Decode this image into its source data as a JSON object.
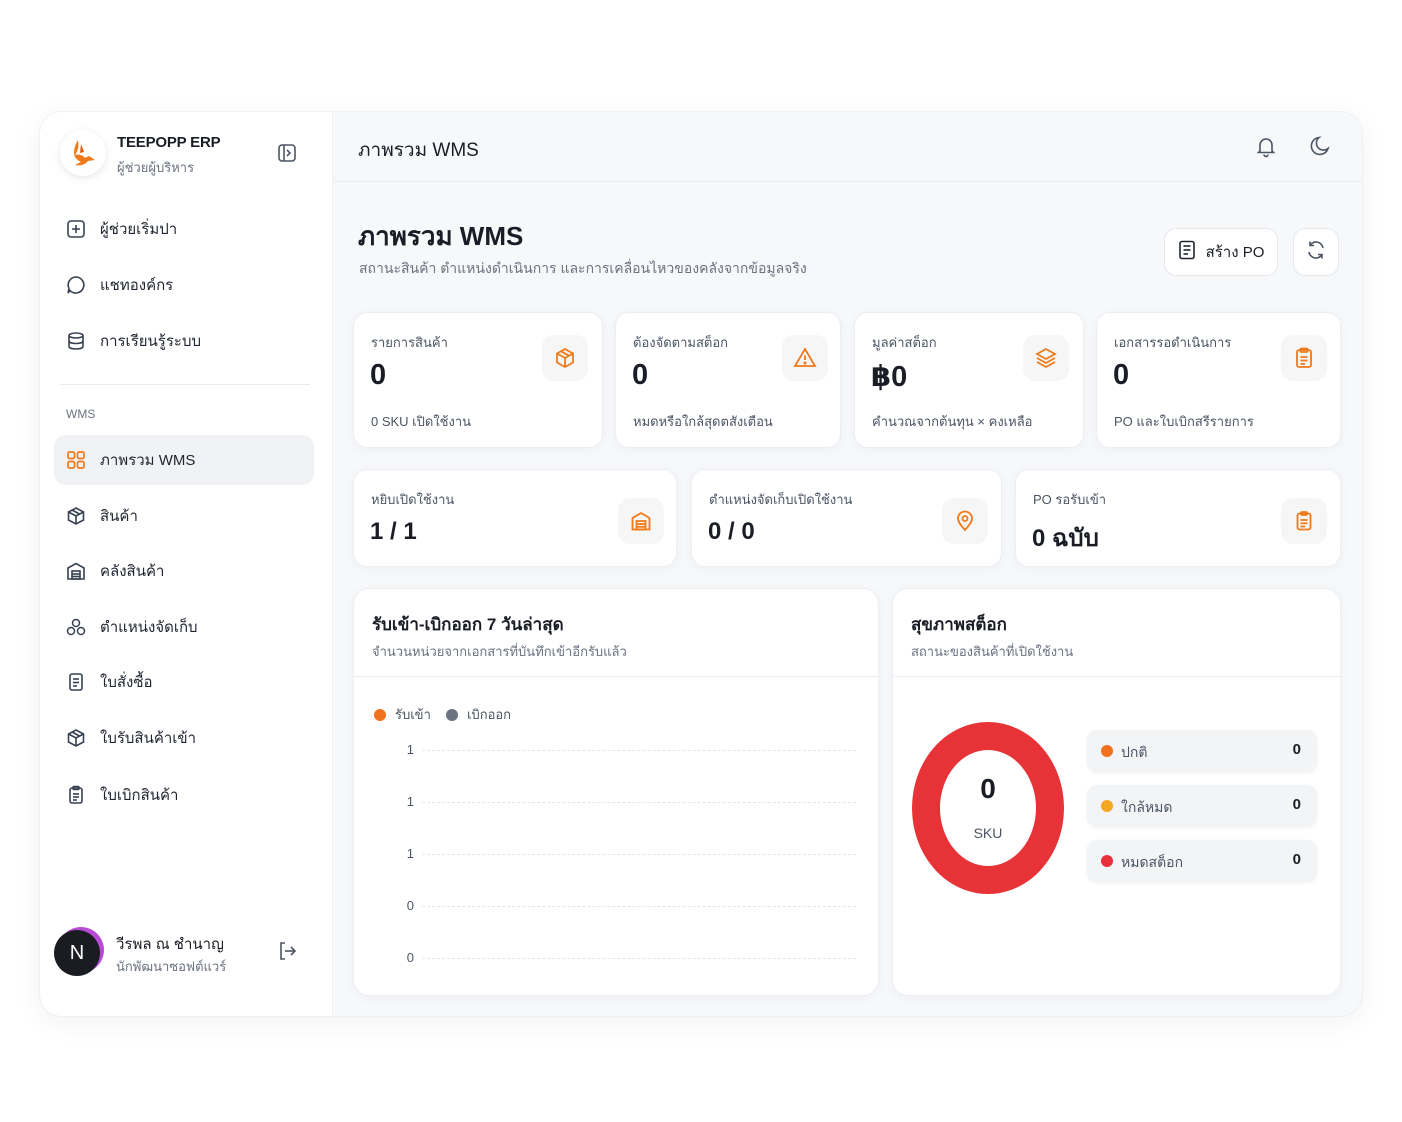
{
  "colors": {
    "accent": "#f07a1a",
    "inbound": "#f2711c",
    "outbound": "#6b7280",
    "normal": "#f2711c",
    "low": "#f5a623",
    "out": "#e8313b",
    "donut": "#e73338"
  },
  "brand": {
    "title": "TEEPOPP ERP",
    "subtitle": "ผู้ช่วยผู้บริหาร"
  },
  "nav_top": [
    {
      "label": "ผู้ช่วยเริ่มปา",
      "icon": "plus-square-icon"
    },
    {
      "label": "แชทองค์กร",
      "icon": "chat-bubble-icon"
    },
    {
      "label": "การเรียนรู้ระบบ",
      "icon": "database-icon"
    }
  ],
  "section_label": "WMS",
  "nav_wms": [
    {
      "label": "ภาพรวม WMS",
      "icon": "grid-icon",
      "active": true
    },
    {
      "label": "สินค้า",
      "icon": "box-icon"
    },
    {
      "label": "คลังสินค้า",
      "icon": "warehouse-icon"
    },
    {
      "label": "ตำแหน่งจัดเก็บ",
      "icon": "location-cluster-icon"
    },
    {
      "label": "ใบสั่งซื้อ",
      "icon": "document-icon"
    },
    {
      "label": "ใบรับสินค้าเข้า",
      "icon": "box-icon"
    },
    {
      "label": "ใบเบิกสินค้า",
      "icon": "clipboard-icon"
    }
  ],
  "user": {
    "initial": "N",
    "name": "วีรพล ณ ชำนาญ",
    "role": "นักพัฒนาซอฟต์แวร์"
  },
  "topbar": {
    "title": "ภาพรวม WMS"
  },
  "page": {
    "title": "ภาพรวม WMS",
    "subtitle": "สถานะสินค้า ตำแหน่งดำเนินการ และการเคลื่อนไหวของคลังจากข้อมูลจริง",
    "create_po": "สร้าง PO"
  },
  "stats": [
    {
      "label": "รายการสินค้า",
      "value": "0",
      "note": "0 SKU เปิดใช้งาน",
      "icon": "package-icon"
    },
    {
      "label": "ต้องจัดตามสต็อก",
      "value": "0",
      "note": "หมดหรือใกล้สุดตสังเตือน",
      "icon": "warning-triangle-icon"
    },
    {
      "label": "มูลค่าสต็อก",
      "value": "฿0",
      "note": "คำนวณจากต้นทุน × คงเหลือ",
      "icon": "layers-icon"
    },
    {
      "label": "เอกสารรอดำเนินการ",
      "value": "0",
      "note": "PO และใบเบิกสรีรายการ",
      "icon": "clipboard-list-icon"
    }
  ],
  "stats2": [
    {
      "label": "หยิบเปิดใช้งาน",
      "value": "1 / 1",
      "icon": "warehouse-icon"
    },
    {
      "label": "ตำแหน่งจัดเก็บเปิดใช้งาน",
      "value": "0 / 0",
      "icon": "map-pin-icon"
    },
    {
      "label": "PO รอรับเข้า",
      "value": "0 ฉบับ",
      "icon": "clipboard-list-icon"
    }
  ],
  "movement": {
    "title": "รับเข้า-เบิกออก 7 วันล่าสุด",
    "subtitle": "จำนวนหน่วยจากเอกสารที่บันทึกเข้าอีกรับแล้ว",
    "legend": [
      "รับเข้า",
      "เบิกออก"
    ],
    "ticks": [
      "1",
      "1",
      "1",
      "0",
      "0"
    ]
  },
  "chart_data": {
    "type": "line",
    "series": [
      {
        "name": "รับเข้า",
        "values": []
      },
      {
        "name": "เบิกออก",
        "values": []
      }
    ],
    "ytick_labels": [
      "1",
      "1",
      "1",
      "0",
      "0"
    ],
    "grid": true,
    "legend_position": "top-left"
  },
  "health": {
    "title": "สุขภาพสต็อก",
    "subtitle": "สถานะของสินค้าที่เปิดใช้งาน",
    "total": "0",
    "unit": "SKU",
    "rows": [
      {
        "label": "ปกติ",
        "value": "0"
      },
      {
        "label": "ใกล้หมด",
        "value": "0"
      },
      {
        "label": "หมดสต็อก",
        "value": "0"
      }
    ]
  }
}
